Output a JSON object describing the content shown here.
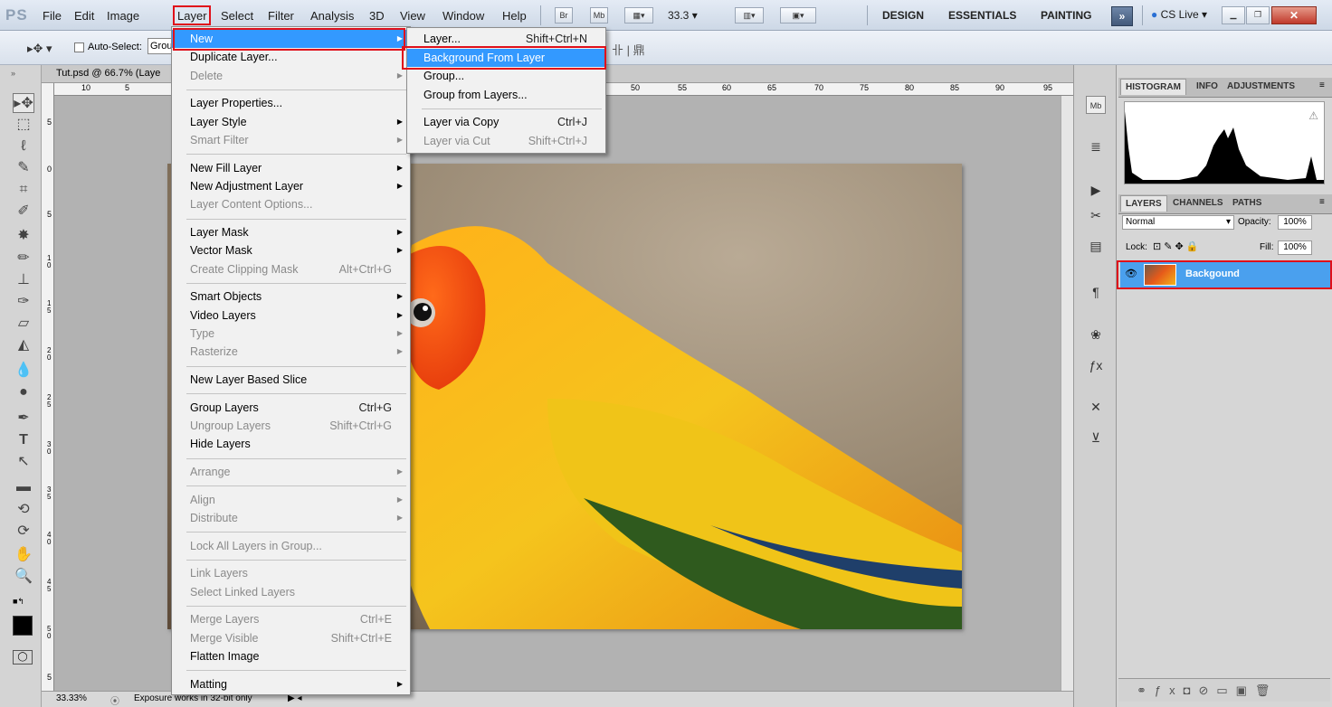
{
  "app": {
    "logo": "PS"
  },
  "menubar": {
    "items": [
      "File",
      "Edit",
      "Image",
      "Layer",
      "Select",
      "Filter",
      "Analysis",
      "3D",
      "View",
      "Window",
      "Help"
    ],
    "bridge": "Br",
    "minibridge": "Mb",
    "zoom": "33.3 ▾",
    "workspaces": [
      "DESIGN",
      "ESSENTIALS",
      "PAINTING"
    ],
    "more": "»",
    "cslive": "CS Live ▾"
  },
  "options": {
    "auto_select_label": "Auto-Select:",
    "auto_select_value": "Grou"
  },
  "document": {
    "tab_title": "Tut.psd @ 66.7% (Laye",
    "ruler_h_left": [
      "10",
      "5"
    ],
    "ruler_h_right": [
      "50",
      "55",
      "60",
      "65",
      "70",
      "75",
      "80",
      "85",
      "90",
      "95"
    ],
    "ruler_v": [
      "5",
      "0",
      "5",
      "1 0",
      "1 5",
      "2 0",
      "2 5",
      "3 0",
      "3 5",
      "4 0",
      "4 5",
      "5 0",
      "5"
    ],
    "zoom_status": "33.33%",
    "status_text": "Exposure works in 32-bit only"
  },
  "layer_menu": {
    "items": [
      {
        "label": "New",
        "arrow": true,
        "highlight": true
      },
      {
        "label": "Duplicate Layer..."
      },
      {
        "label": "Delete",
        "arrow": true,
        "disabled": true
      },
      {
        "sep": true
      },
      {
        "label": "Layer Properties..."
      },
      {
        "label": "Layer Style",
        "arrow": true
      },
      {
        "label": "Smart Filter",
        "arrow": true,
        "disabled": true
      },
      {
        "sep": true
      },
      {
        "label": "New Fill Layer",
        "arrow": true
      },
      {
        "label": "New Adjustment Layer",
        "arrow": true
      },
      {
        "label": "Layer Content Options...",
        "disabled": true
      },
      {
        "sep": true
      },
      {
        "label": "Layer Mask",
        "arrow": true
      },
      {
        "label": "Vector Mask",
        "arrow": true
      },
      {
        "label": "Create Clipping Mask",
        "shortcut": "Alt+Ctrl+G",
        "disabled": true
      },
      {
        "sep": true
      },
      {
        "label": "Smart Objects",
        "arrow": true
      },
      {
        "label": "Video Layers",
        "arrow": true
      },
      {
        "label": "Type",
        "arrow": true,
        "disabled": true
      },
      {
        "label": "Rasterize",
        "arrow": true,
        "disabled": true
      },
      {
        "sep": true
      },
      {
        "label": "New Layer Based Slice"
      },
      {
        "sep": true
      },
      {
        "label": "Group Layers",
        "shortcut": "Ctrl+G"
      },
      {
        "label": "Ungroup Layers",
        "shortcut": "Shift+Ctrl+G",
        "disabled": true
      },
      {
        "label": "Hide Layers"
      },
      {
        "sep": true
      },
      {
        "label": "Arrange",
        "arrow": true,
        "disabled": true
      },
      {
        "sep": true
      },
      {
        "label": "Align",
        "arrow": true,
        "disabled": true
      },
      {
        "label": "Distribute",
        "arrow": true,
        "disabled": true
      },
      {
        "sep": true
      },
      {
        "label": "Lock All Layers in Group...",
        "disabled": true
      },
      {
        "sep": true
      },
      {
        "label": "Link Layers",
        "disabled": true
      },
      {
        "label": "Select Linked Layers",
        "disabled": true
      },
      {
        "sep": true
      },
      {
        "label": "Merge Layers",
        "shortcut": "Ctrl+E",
        "disabled": true
      },
      {
        "label": "Merge Visible",
        "shortcut": "Shift+Ctrl+E",
        "disabled": true
      },
      {
        "label": "Flatten Image"
      },
      {
        "sep": true
      },
      {
        "label": "Matting",
        "arrow": true
      }
    ]
  },
  "new_submenu": {
    "items": [
      {
        "label": "Layer...",
        "shortcut": "Shift+Ctrl+N"
      },
      {
        "label": "Background From Layer",
        "highlight": true
      },
      {
        "label": "Group..."
      },
      {
        "label": "Group from Layers..."
      },
      {
        "sep": true
      },
      {
        "label": "Layer via Copy",
        "shortcut": "Ctrl+J"
      },
      {
        "label": "Layer via Cut",
        "shortcut": "Shift+Ctrl+J",
        "disabled": true
      }
    ]
  },
  "panels": {
    "top_tabs": [
      "HISTOGRAM",
      "INFO",
      "ADJUSTMENTS"
    ],
    "layer_tabs": [
      "LAYERS",
      "CHANNELS",
      "PATHS"
    ],
    "blend_mode": "Normal",
    "opacity_label": "Opacity:",
    "opacity_value": "100%",
    "lock_label": "Lock:",
    "fill_label": "Fill:",
    "fill_value": "100%",
    "layer_name": "Backgound",
    "warning": "⚠"
  },
  "colors": {
    "highlight": "#3399ff",
    "annotation_red": "#e0101a",
    "layer_selected": "#4aa0ee"
  }
}
